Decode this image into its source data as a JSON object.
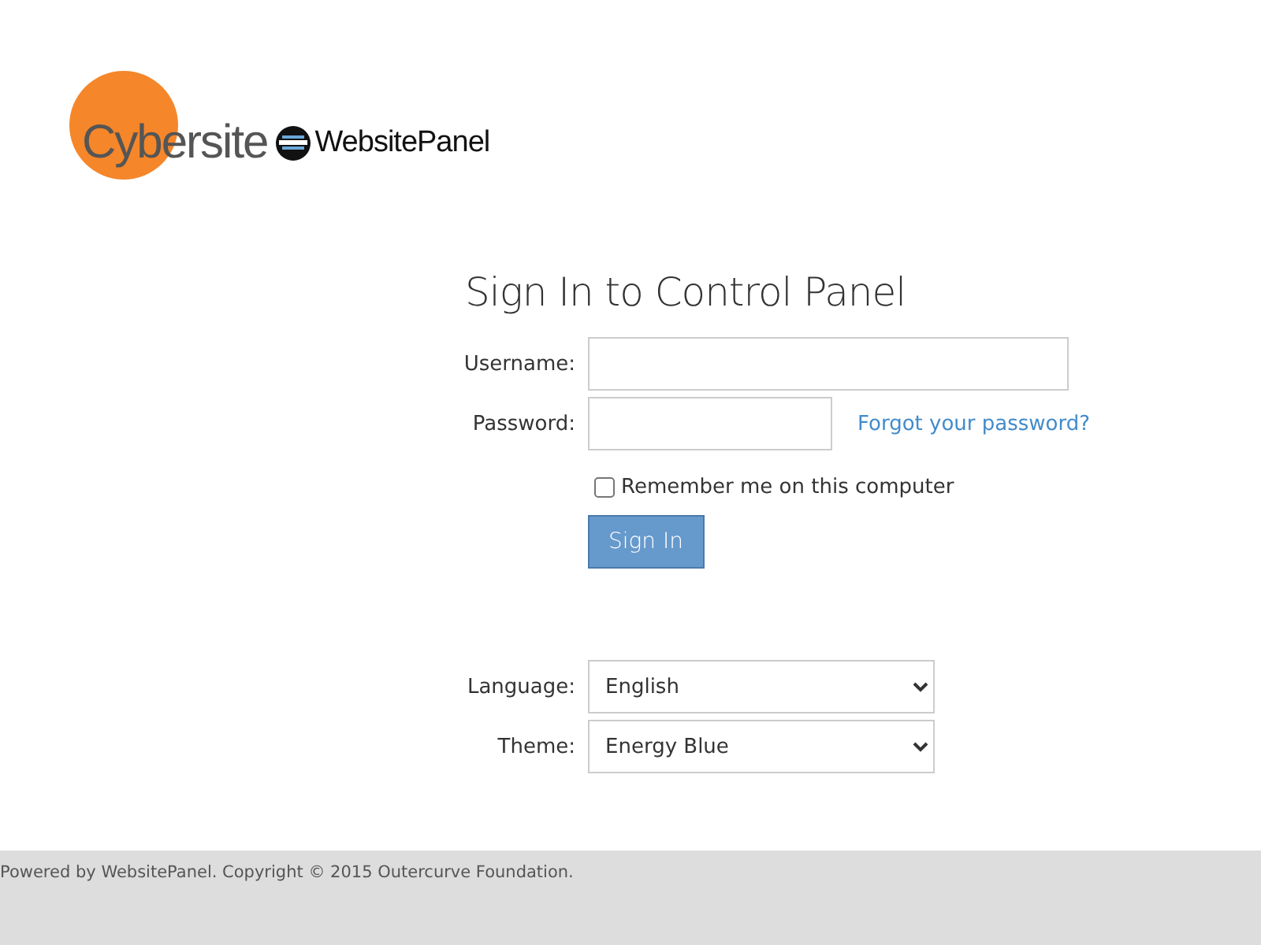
{
  "logo": {
    "brand": "Cybersite",
    "product": "WebsitePanel"
  },
  "title": "Sign In to Control Panel",
  "username": {
    "label": "Username:"
  },
  "password": {
    "label": "Password:",
    "link": "Forgot your password?"
  },
  "remember": {
    "label": "Remember me on this computer",
    "checked": false
  },
  "sign_in_button": "Sign In",
  "language": {
    "label": "Language:",
    "value": "English"
  },
  "theme": {
    "label": "Theme:",
    "value": "Energy Blue"
  },
  "footer": "Powered by WebsitePanel. Copyright © 2015 Outercurve Foundation."
}
